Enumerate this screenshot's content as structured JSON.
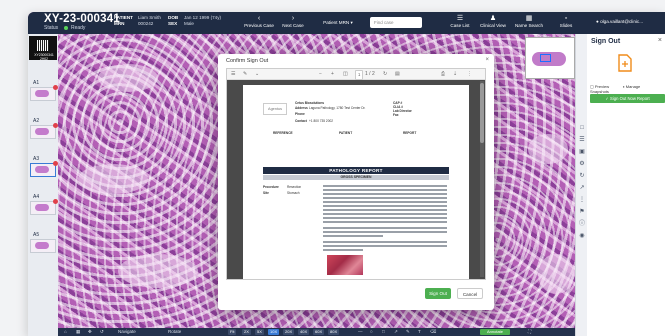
{
  "topbar": {
    "case_id": "XY-23-000341",
    "status_label": "Status",
    "status_value": "Ready",
    "patient_label": "PATIENT",
    "patient_name": "Liam Smith",
    "mrn_label": "MRN",
    "mrn_value": "000242",
    "dob_label": "DOB",
    "dob_value": "Jan 12 1999 (74y)",
    "sex_label": "SEX",
    "sex_value": "Male",
    "previous_case": "Previous Case",
    "next_case": "Next Case",
    "patient_mrn": "Patient MRN",
    "search_placeholder": "Find case",
    "case_list": "Case List",
    "clinical_view": "Clinical View",
    "name_search": "Name Search",
    "slides": "Slides",
    "user": "olga.vaillant@clinic..."
  },
  "slides": {
    "label_text": "XY23000341 2H02",
    "items": [
      {
        "name": "A1"
      },
      {
        "name": "A2"
      },
      {
        "name": "A3"
      },
      {
        "name": "A4"
      },
      {
        "name": "A5"
      }
    ]
  },
  "sign_panel": {
    "title": "Sign Out",
    "preview": "Preview",
    "manage_snapshots": "Manage Snapshots",
    "sign_out_button": "Sign Out Now Report",
    "accent": "#4caf50"
  },
  "dialog": {
    "title": "Confirm Sign Out",
    "page_indicator": "1 / 2",
    "sign_out": "Sign Out",
    "cancel": "Cancel",
    "report": {
      "logo": "Agentus",
      "clinic_name": "Cetus Biosolutions",
      "address_label": "Address",
      "address": "Laguna Pathology, 1780 Test Center Dr.",
      "phone_label": "Phone",
      "contact_label": "Contact",
      "contact": "+1 800 735 2002",
      "cap_label": "CAP #",
      "clia_label": "CLIA #",
      "lab_director_label": "Lab Director",
      "fax_label": "Fax",
      "referrer_head": "REFERENCE",
      "patient_head": "PATIENT",
      "report_head": "REPORT",
      "banner": "PATHOLOGY REPORT",
      "subheading": "GROSS SPECIMEN",
      "procedure_label": "Procedure",
      "procedure_value": "Resection",
      "site_label": "Site",
      "site_value": "Stomach"
    }
  },
  "bottombar": {
    "zoom_levels": [
      "Fit",
      "2X",
      "5X",
      "10X",
      "20X",
      "40X",
      "60X",
      "80X"
    ],
    "active_zoom": "10X",
    "overlay": "Annotate",
    "nav_left": "Navigate",
    "nav_right": "Rotate"
  }
}
